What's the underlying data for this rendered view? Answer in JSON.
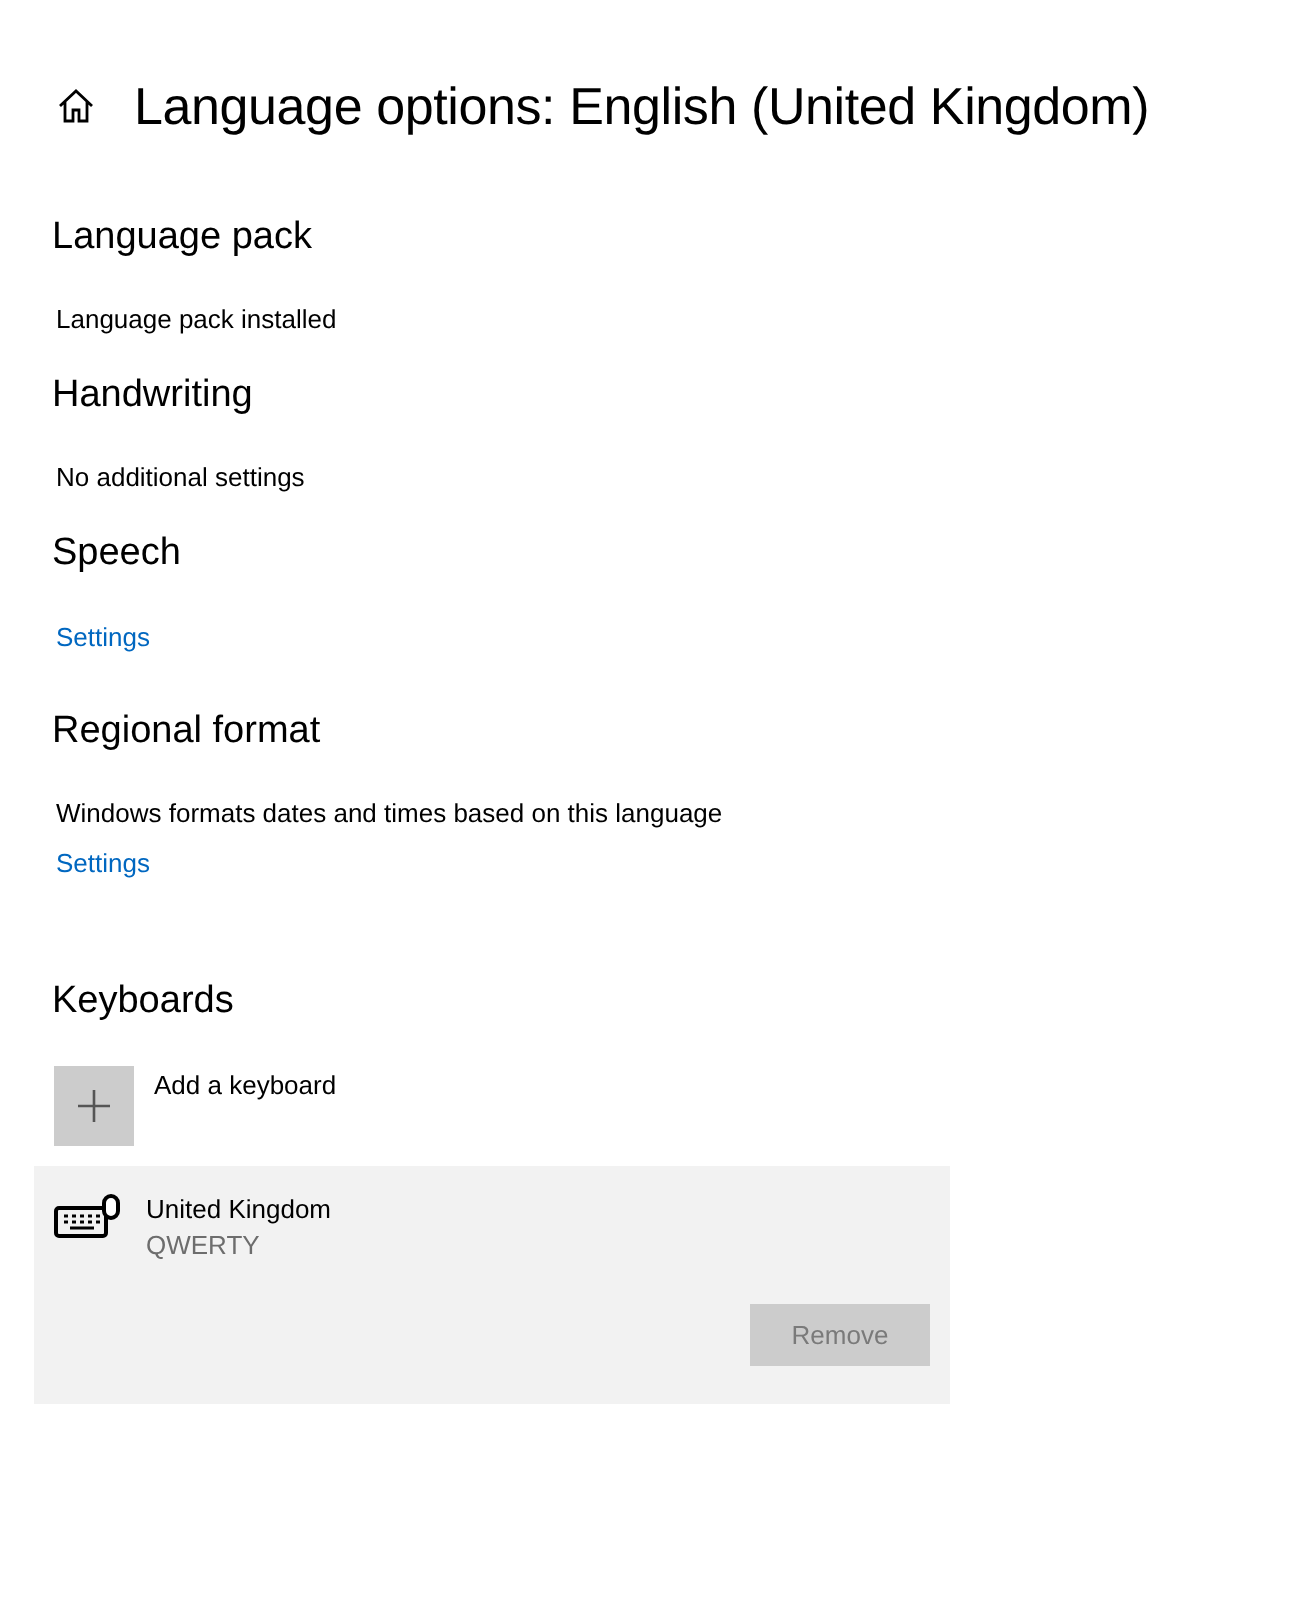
{
  "page_title": "Language options: English (United Kingdom)",
  "sections": [
    {
      "heading": "Language pack",
      "items": [
        {
          "kind": "text",
          "text": "Language pack installed"
        }
      ]
    },
    {
      "heading": "Handwriting",
      "items": [
        {
          "kind": "text",
          "text": "No additional settings"
        }
      ]
    },
    {
      "heading": "Speech",
      "items": [
        {
          "kind": "link",
          "text": "Settings"
        }
      ]
    },
    {
      "heading": "Regional format",
      "items": [
        {
          "kind": "text",
          "text": "Windows formats dates and times based on this language"
        },
        {
          "kind": "link",
          "text": "Settings"
        }
      ]
    }
  ],
  "keyboards": {
    "heading": "Keyboards",
    "add_label": "Add a keyboard",
    "items": [
      {
        "name": "United Kingdom",
        "layout": "QWERTY",
        "selected": true,
        "remove_label": "Remove",
        "remove_disabled": true
      }
    ]
  }
}
